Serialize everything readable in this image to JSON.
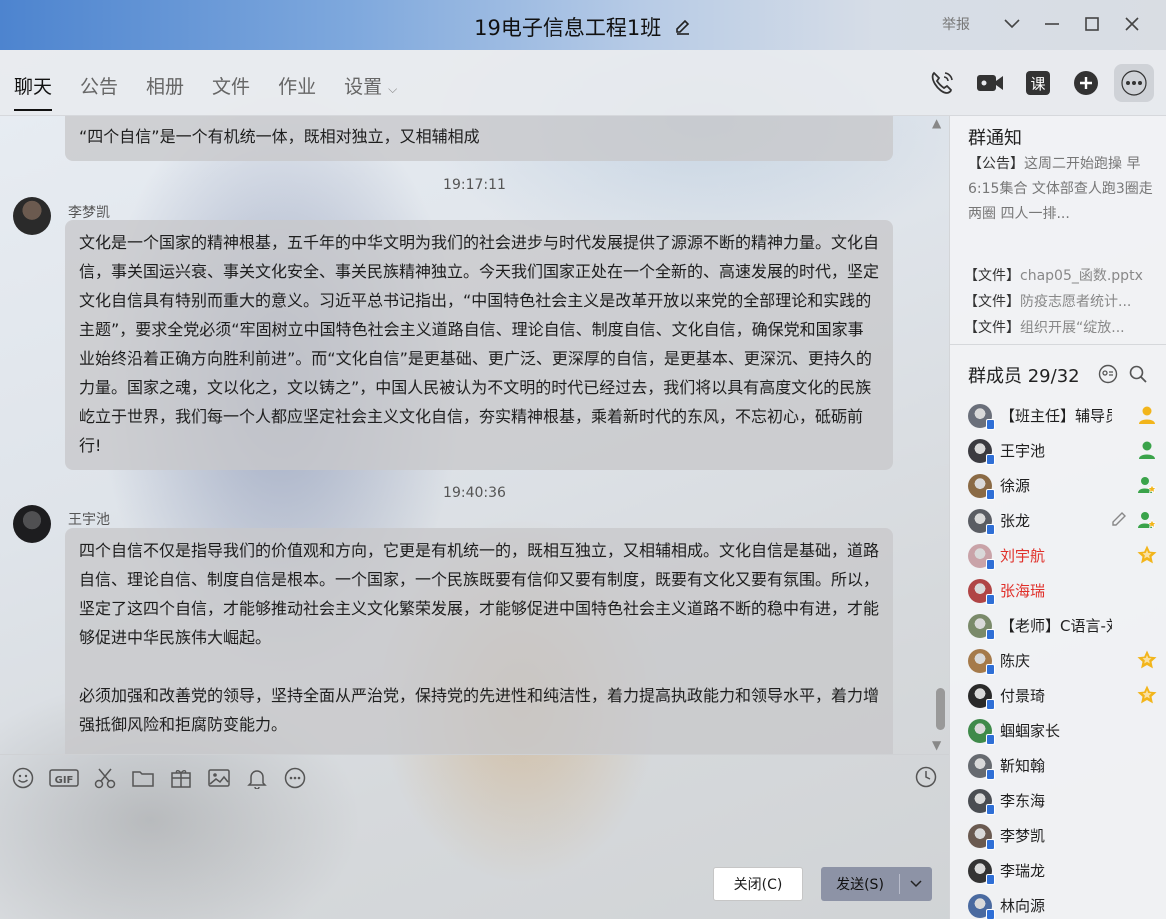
{
  "window": {
    "title": "19电子信息工程1班",
    "report_label": "举报"
  },
  "tabs": [
    {
      "label": "聊天",
      "active": true
    },
    {
      "label": "公告",
      "active": false
    },
    {
      "label": "相册",
      "active": false
    },
    {
      "label": "文件",
      "active": false
    },
    {
      "label": "作业",
      "active": false
    },
    {
      "label": "设置",
      "active": false
    }
  ],
  "nav_tools": [
    "voice-call-icon",
    "video-call-icon",
    "class-icon",
    "add-icon",
    "more-icon"
  ],
  "nav_tools_class_label": "课",
  "chat": {
    "messages": [
      {
        "text": "“四个自信”是一个有机统一体，既相对独立，又相辅相成"
      },
      {
        "timestamp": "19:17:11",
        "sender": "李梦凯",
        "text": "文化是一个国家的精神根基，五千年的中华文明为我们的社会进步与时代发展提供了源源不断的精神力量。文化自信，事关国运兴衰、事关文化安全、事关民族精神独立。今天我们国家正处在一个全新的、高速发展的时代，坚定文化自信具有特别而重大的意义。习近平总书记指出，“中国特色社会主义是改革开放以来党的全部理论和实践的主题”，要求全党必须“牢固树立中国特色社会主义道路自信、理论自信、制度自信、文化自信，确保党和国家事业始终沿着正确方向胜利前进”。而“文化自信”是更基础、更广泛、更深厚的自信，是更基本、更深沉、更持久的力量。国家之魂，文以化之，文以铸之”，中国人民被认为不文明的时代已经过去，我们将以具有高度文化的民族屹立于世界，我们每一个人都应坚定社会主义文化自信，夯实精神根基，乘着新时代的东风，不忘初心，砥砺前行!"
      },
      {
        "timestamp": "19:40:36",
        "sender": "王宇池",
        "text": "四个自信不仅是指导我们的价值观和方向，它更是有机统一的，既相互独立，又相辅相成。文化自信是基础，道路自信、理论自信、制度自信是根本。一个国家，一个民族既要有信仰又要有制度，既要有文化又要有氛围。所以，坚定了这四个自信，才能够推动社会主义文化繁荣发展，才能够促进中国特色社会主义道路不断的稳中有进，才能够促进中华民族伟大崛起。\n\n必须加强和改善党的领导，坚持全面从严治党，保持党的先进性和纯洁性，着力提高执政能力和领导水平，着力增强抵御风险和拒腐防变能力。"
      }
    ]
  },
  "toolbar": {
    "icons": [
      "emoji-icon",
      "gif-icon",
      "scissors-icon",
      "folder-icon",
      "gift-icon",
      "image-icon",
      "bell-icon",
      "more-dots-icon"
    ],
    "gif_label": "GIF",
    "history_icon": "clock-icon"
  },
  "buttons": {
    "close": "关闭(C)",
    "send": "发送(S)"
  },
  "group_notice": {
    "title": "群通知",
    "announcement_tag": "【公告】",
    "announcement_text": "这周二开始跑操 早6:15集合 文体部查人跑3圈走两圈 四人一排...",
    "files": [
      {
        "tag": "【文件】",
        "name": "chap05_函数.pptx"
      },
      {
        "tag": "【文件】",
        "name": "防疫志愿者统计..."
      },
      {
        "tag": "【文件】",
        "name": "组织开展“绽放..."
      }
    ]
  },
  "members": {
    "title": "群成员 29/32",
    "list": [
      {
        "name": "【班主任】辅导员",
        "red": false,
        "role": "admin",
        "avatar_color": "#6a6f7a"
      },
      {
        "name": "王宇池",
        "red": false,
        "role": "admin",
        "avatar_color": "#3b3b40"
      },
      {
        "name": "徐源",
        "red": false,
        "role": "admin-star",
        "avatar_color": "#8a6a45"
      },
      {
        "name": "张龙",
        "red": false,
        "role": "admin-star",
        "edit": true,
        "avatar_color": "#5a5d63"
      },
      {
        "name": "刘宇航",
        "red": true,
        "role": "star",
        "avatar_color": "#c9a3a8"
      },
      {
        "name": "张海瑞",
        "red": true,
        "role": "none",
        "avatar_color": "#b04545"
      },
      {
        "name": "【老师】C语言-刘",
        "red": false,
        "role": "none",
        "avatar_color": "#7a8a6a"
      },
      {
        "name": "陈庆",
        "red": false,
        "role": "star",
        "avatar_color": "#a57a4a"
      },
      {
        "name": "付景琦",
        "red": false,
        "role": "star",
        "avatar_color": "#2a2a2a"
      },
      {
        "name": "蝈蝈家长",
        "red": false,
        "role": "none",
        "avatar_color": "#3f8a4a"
      },
      {
        "name": "靳知翰",
        "red": false,
        "role": "none",
        "avatar_color": "#666a70"
      },
      {
        "name": "李东海",
        "red": false,
        "role": "none",
        "avatar_color": "#4a4d52"
      },
      {
        "name": "李梦凯",
        "red": false,
        "role": "none",
        "avatar_color": "#6a5a50"
      },
      {
        "name": "李瑞龙",
        "red": false,
        "role": "none",
        "avatar_color": "#333"
      },
      {
        "name": "林向源",
        "red": false,
        "role": "none",
        "avatar_color": "#4a6aa0"
      }
    ]
  },
  "colors": {
    "accent": "#2f6fd6",
    "admin_green": "#3aa34a",
    "star_gold": "#f2b51b",
    "red_name": "#e0302a"
  }
}
